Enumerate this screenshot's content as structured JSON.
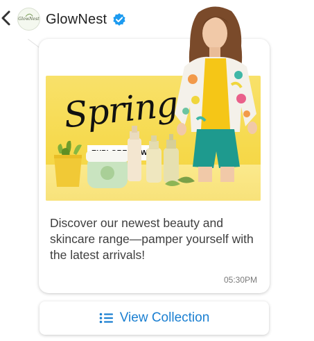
{
  "header": {
    "brand_name": "GlowNest",
    "avatar_text": "GlowNest"
  },
  "banner": {
    "headline": "Spring",
    "cta": "EXPLORE NOW"
  },
  "message": {
    "text": "Discover our newest beauty and skincare range—pamper yourself with the latest arrivals!",
    "time": "05:30PM"
  },
  "action": {
    "label": "View Collection"
  },
  "colors": {
    "accent": "#1a7fd1",
    "banner_yellow": "#f6d94b",
    "verified": "#1d9bf0"
  }
}
